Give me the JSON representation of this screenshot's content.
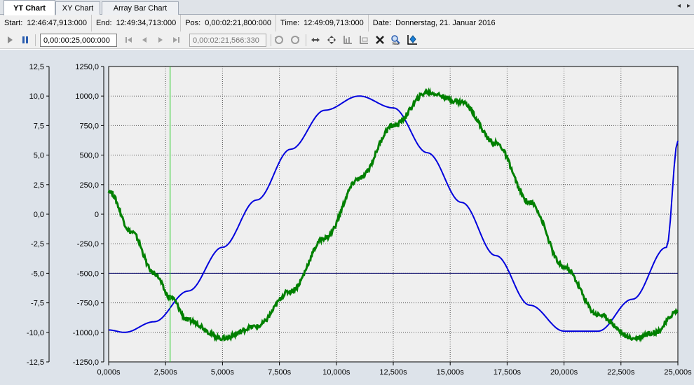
{
  "tabs": [
    {
      "label": "YT Chart",
      "active": true
    },
    {
      "label": "XY Chart",
      "active": false
    },
    {
      "label": "Array Bar Chart",
      "active": false
    }
  ],
  "tab_nav": {
    "prev": "◂",
    "next": "▸"
  },
  "infobar": {
    "start_label": "Start:",
    "start_value": "12:46:47,913:000",
    "end_label": "End:",
    "end_value": "12:49:34,713:000",
    "pos_label": "Pos:",
    "pos_value": "0,00:02:21,800:000",
    "time_label": "Time:",
    "time_value": "12:49:09,713:000",
    "date_label": "Date:",
    "date_value": "Donnerstag, 21. Januar 2016"
  },
  "toolbar": {
    "interval_value": "0,00:00:25,000:000",
    "position_value": "0,00:02:21,566:330",
    "icons": [
      "play-icon",
      "pause-icon",
      "skip-start-icon",
      "step-back-icon",
      "step-forward-icon",
      "skip-end-icon",
      "undo-icon",
      "redo-icon",
      "pan-horizontal-icon",
      "pan-all-icon",
      "scale-icon",
      "scale-rect-icon",
      "cursor-off-icon",
      "zoom-max-icon",
      "zoom-fit-icon"
    ]
  },
  "chart_data": {
    "type": "line",
    "x_unit": "s",
    "x_range": [
      0,
      25
    ],
    "x_ticks": [
      "0,000s",
      "2,500s",
      "5,000s",
      "7,500s",
      "10,000s",
      "12,500s",
      "15,000s",
      "17,500s",
      "20,000s",
      "22,500s",
      "25,000s"
    ],
    "axis_left": {
      "range": [
        -12.5,
        12.5
      ],
      "ticks": [
        "12,5",
        "10,0",
        "7,5",
        "5,0",
        "2,5",
        "0,0",
        "-2,5",
        "-5,0",
        "-7,5",
        "-10,0",
        "-12,5"
      ]
    },
    "axis_right": {
      "range": [
        -1250,
        1250
      ],
      "ticks": [
        "1250,0",
        "1000,0",
        "750,0",
        "500,0",
        "250,0",
        "0",
        "-250,0",
        "-500,0",
        "-750,0",
        "-1000,0",
        "-1250,0"
      ]
    },
    "grid": true,
    "cursor_x": 2.7,
    "reference_line_y": -500,
    "series": [
      {
        "color": "#0000dd",
        "axis": "right",
        "x": [
          0,
          0.7,
          2,
          3.5,
          5,
          6.5,
          8,
          9.5,
          11,
          12.5,
          14,
          15.5,
          17,
          18.5,
          20,
          21.5,
          23,
          24.5,
          25
        ],
        "y": [
          -980,
          -1000,
          -910,
          -650,
          -280,
          120,
          550,
          880,
          1000,
          900,
          520,
          100,
          -350,
          -770,
          -990,
          -990,
          -720,
          -280,
          620
        ]
      },
      {
        "color": "#008000",
        "axis": "right",
        "noisy": true,
        "x": [
          0,
          1,
          2,
          2.7,
          3.5,
          5,
          6.5,
          8,
          9.5,
          11,
          12.5,
          14,
          15.5,
          17,
          18.5,
          20,
          21.5,
          23,
          24,
          25
        ],
        "y": [
          200,
          -150,
          -500,
          -700,
          -900,
          -1050,
          -950,
          -650,
          -200,
          300,
          750,
          1030,
          950,
          600,
          100,
          -450,
          -850,
          -1050,
          -1000,
          -820
        ]
      }
    ]
  }
}
